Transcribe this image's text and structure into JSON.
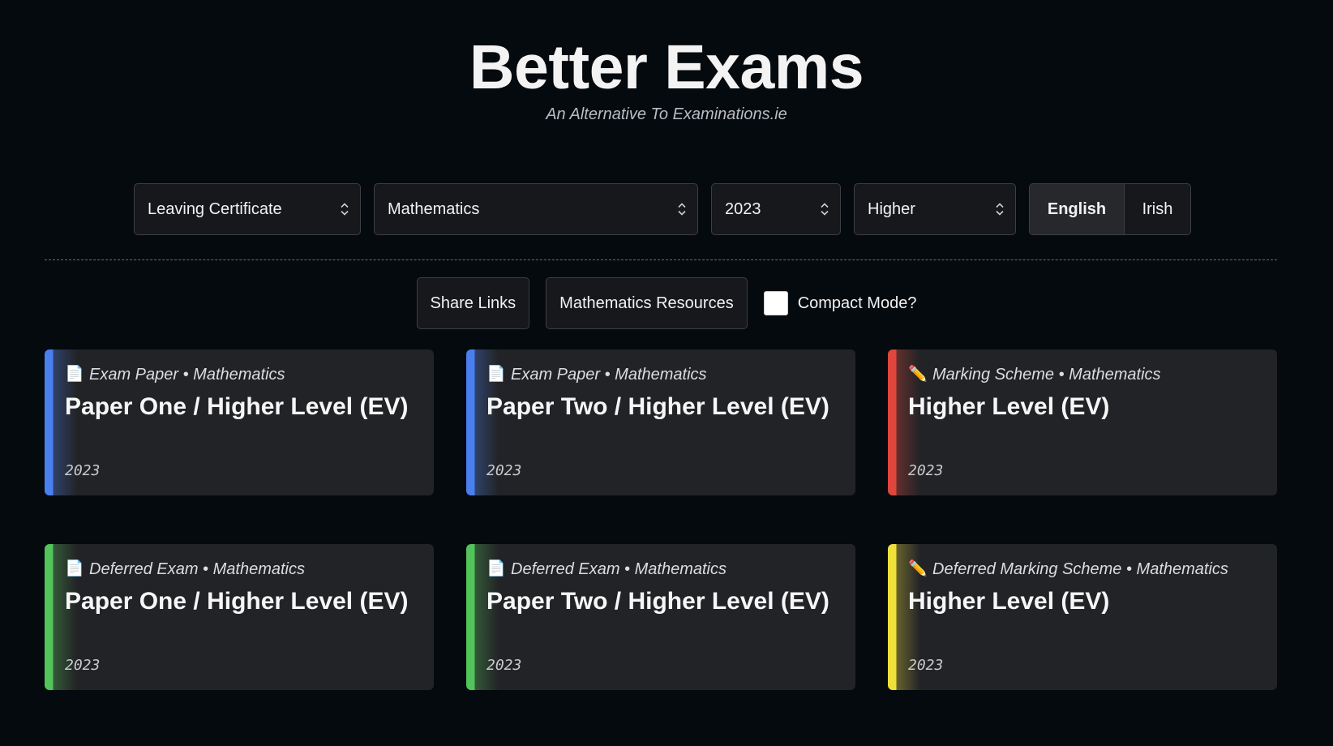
{
  "header": {
    "title": "Better Exams",
    "subtitle": "An Alternative To Examinations.ie"
  },
  "filters": {
    "certificate": "Leaving Certificate",
    "subject": "Mathematics",
    "year": "2023",
    "level": "Higher",
    "language_options": [
      "English",
      "Irish"
    ],
    "language_selected": "English"
  },
  "actions": {
    "share_links": "Share Links",
    "resources": "Mathematics Resources",
    "compact_mode_label": "Compact Mode?",
    "compact_mode_checked": false
  },
  "cards": [
    {
      "icon": "document-icon",
      "glyph": "📄",
      "type": "Exam Paper",
      "subject": "Mathematics",
      "meta": "Exam Paper • Mathematics",
      "title": "Paper One / Higher Level (EV)",
      "year": "2023",
      "accent": "#4a7ff0"
    },
    {
      "icon": "document-icon",
      "glyph": "📄",
      "type": "Exam Paper",
      "subject": "Mathematics",
      "meta": "Exam Paper • Mathematics",
      "title": "Paper Two / Higher Level (EV)",
      "year": "2023",
      "accent": "#4a7ff0"
    },
    {
      "icon": "pencil-icon",
      "glyph": "✏️",
      "type": "Marking Scheme",
      "subject": "Mathematics",
      "meta": "Marking Scheme • Mathematics",
      "title": "Higher Level (EV)",
      "year": "2023",
      "accent": "#e0463c"
    },
    {
      "icon": "document-icon",
      "glyph": "📄",
      "type": "Deferred Exam",
      "subject": "Mathematics",
      "meta": "Deferred Exam • Mathematics",
      "title": "Paper One / Higher Level (EV)",
      "year": "2023",
      "accent": "#52c45a"
    },
    {
      "icon": "document-icon",
      "glyph": "📄",
      "type": "Deferred Exam",
      "subject": "Mathematics",
      "meta": "Deferred Exam • Mathematics",
      "title": "Paper Two / Higher Level (EV)",
      "year": "2023",
      "accent": "#52c45a"
    },
    {
      "icon": "pencil-icon",
      "glyph": "✏️",
      "type": "Deferred Marking Scheme",
      "subject": "Mathematics",
      "meta": "Deferred Marking Scheme • Mathematics",
      "title": "Higher Level (EV)",
      "year": "2023",
      "accent": "#f0e03a"
    }
  ],
  "colors": {
    "background": "#050a0e",
    "card": "#222326",
    "control": "#17181b",
    "border": "#3c3f45"
  }
}
